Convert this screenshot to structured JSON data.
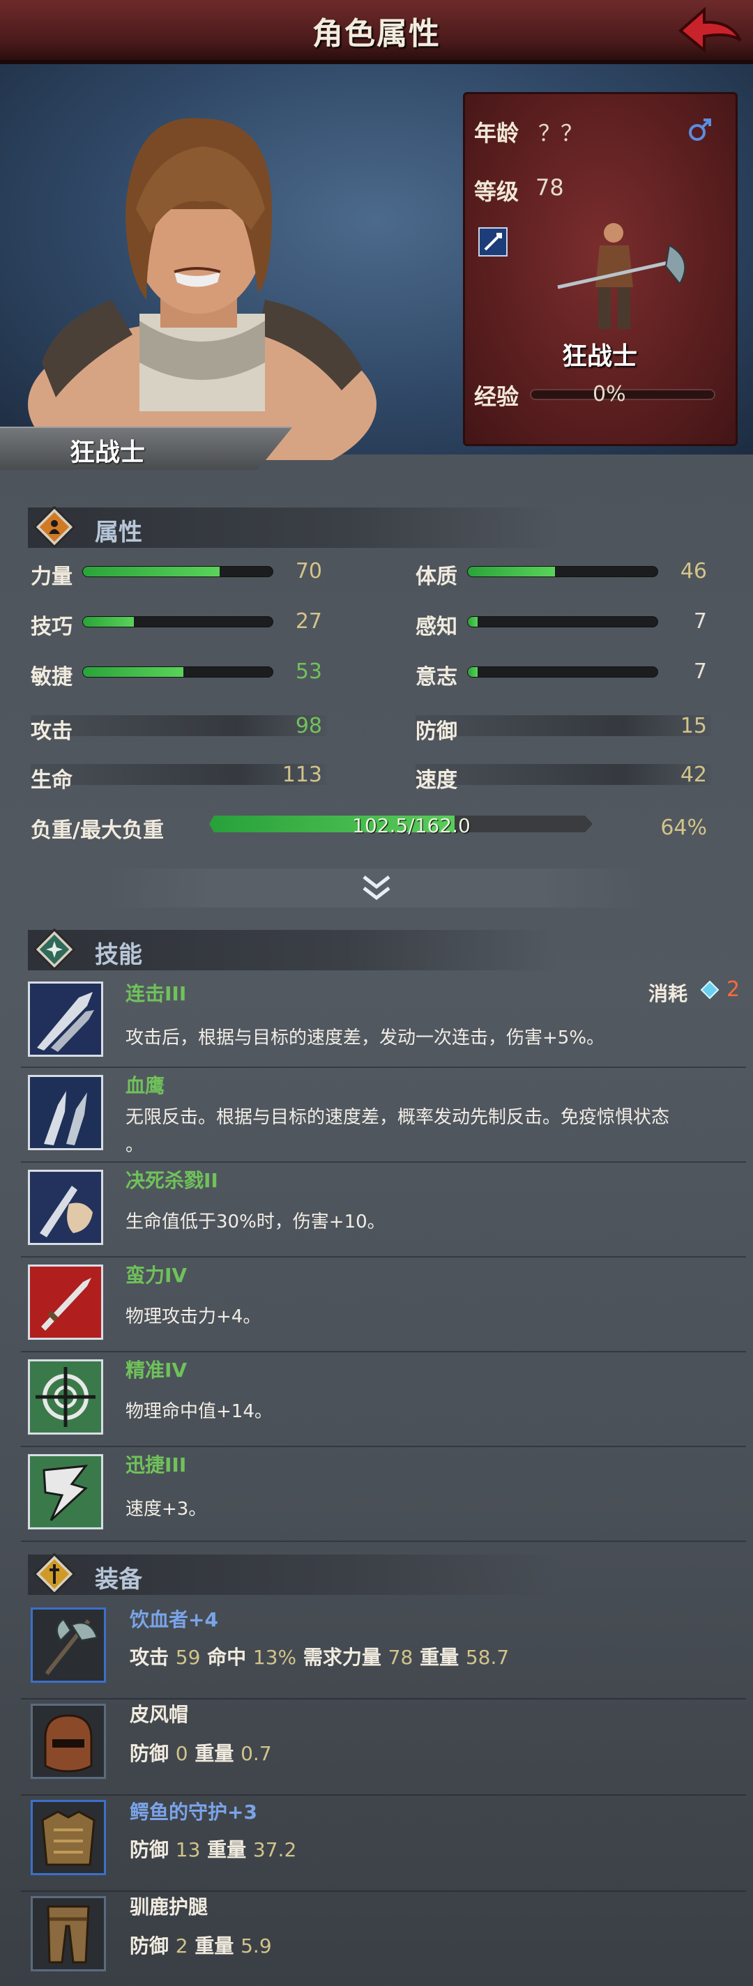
{
  "title": "角色属性",
  "name": "狂战士",
  "info": {
    "age_label": "年龄",
    "age_value": "？？",
    "level_label": "等级",
    "level_value": "78",
    "class_name": "狂战士",
    "exp_label": "经验",
    "exp_value": "0%",
    "exp_progress": 0
  },
  "attributes": {
    "header": "属性",
    "stats": [
      {
        "label": "力量",
        "value": "70",
        "progress": 0.72
      },
      {
        "label": "体质",
        "value": "46",
        "progress": 0.46
      },
      {
        "label": "技巧",
        "value": "27",
        "progress": 0.27
      },
      {
        "label": "感知",
        "value": "7",
        "progress": 0.05
      },
      {
        "label": "敏捷",
        "value": "53",
        "progress": 0.53
      },
      {
        "label": "意志",
        "value": "7",
        "progress": 0.05
      }
    ],
    "attack_label": "攻击",
    "attack_value": "98",
    "defense_label": "防御",
    "defense_value": "15",
    "hp_label": "生命",
    "hp_value": "113",
    "speed_label": "速度",
    "speed_value": "42",
    "load_label": "负重/最大负重",
    "load_value": "102.5/162.0",
    "load_percent": "64%",
    "load_progress": 0.64
  },
  "skills": {
    "header": "技能",
    "cost_label": "消耗",
    "cost_value": "2",
    "items": [
      {
        "name": "连击III",
        "desc": "攻击后，根据与目标的速度差，发动一次连击，伤害+5%。"
      },
      {
        "name": "血鹰",
        "desc": "无限反击。根据与目标的速度差，概率发动先制反击。免疫惊惧状态",
        "desc2": "。"
      },
      {
        "name": "决死杀戮II",
        "desc": "生命值低于30%时，伤害+10。"
      },
      {
        "name": "蛮力IV",
        "desc": "物理攻击力+4。"
      },
      {
        "name": "精准IV",
        "desc": "物理命中值+14。"
      },
      {
        "name": "迅捷III",
        "desc": "速度+3。"
      }
    ]
  },
  "equipment": {
    "header": "装备",
    "items": [
      {
        "name": "饮血者",
        "plus": "+4",
        "stats": [
          [
            "攻击",
            "59"
          ],
          [
            "命中",
            "13%"
          ],
          [
            "需求力量",
            "78"
          ],
          [
            "重量",
            "58.7"
          ]
        ]
      },
      {
        "name": "皮风帽",
        "plus": "",
        "stats": [
          [
            "防御",
            "0"
          ],
          [
            "重量",
            "0.7"
          ]
        ]
      },
      {
        "name": "鳄鱼的守护",
        "plus": "+3",
        "stats": [
          [
            "防御",
            "13"
          ],
          [
            "重量",
            "37.2"
          ]
        ]
      },
      {
        "name": "驯鹿护腿",
        "plus": "",
        "stats": [
          [
            "防御",
            "2"
          ],
          [
            "重量",
            "5.9"
          ]
        ]
      }
    ]
  },
  "colors": {
    "green": "#6fc25a",
    "blue_name": "#7aa4e8",
    "gold": "#d2c48a",
    "cost": "#ff6a3a"
  }
}
